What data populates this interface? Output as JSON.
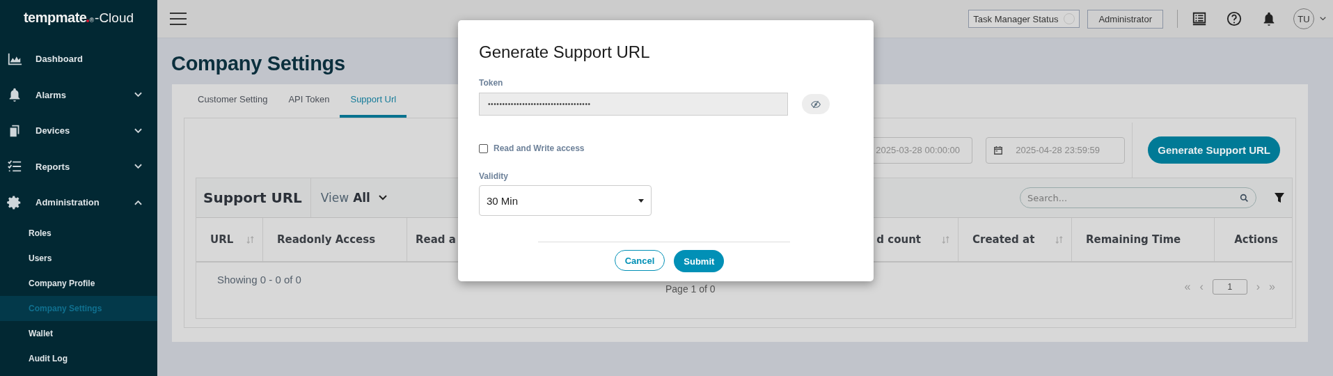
{
  "sidebar": {
    "logo": {
      "name": "tempmate",
      "mark": "®",
      "suffix": "-Cloud"
    },
    "items": [
      {
        "label": "Dashboard",
        "kind": "link"
      },
      {
        "label": "Alarms",
        "kind": "group",
        "expanded": false
      },
      {
        "label": "Devices",
        "kind": "group",
        "expanded": false
      },
      {
        "label": "Reports",
        "kind": "group",
        "expanded": false
      },
      {
        "label": "Administration",
        "kind": "group",
        "expanded": true,
        "children": [
          {
            "label": "Roles",
            "selected": false
          },
          {
            "label": "Users",
            "selected": false
          },
          {
            "label": "Company Profile",
            "selected": false
          },
          {
            "label": "Company Settings",
            "selected": true
          },
          {
            "label": "Wallet",
            "selected": false
          },
          {
            "label": "Audit Log",
            "selected": false
          }
        ]
      }
    ]
  },
  "topbar": {
    "task_status": "Task Manager Status",
    "role": "Administrator",
    "avatar": "TU"
  },
  "page": {
    "title": "Company Settings"
  },
  "tabs": [
    {
      "label": "Customer Setting",
      "selected": false
    },
    {
      "label": "API Token",
      "selected": false
    },
    {
      "label": "Support Url",
      "selected": true
    }
  ],
  "date_range": [
    "2025-03-28 00:00:00",
    "2025-04-28 23:59:59"
  ],
  "generate_button": "Generate Support URL",
  "table": {
    "title": "Support URL",
    "view_label": "View",
    "view_value": "All",
    "search_placeholder": "Search...",
    "columns": [
      {
        "label": "URL",
        "sortable": true
      },
      {
        "label": "Readonly Access",
        "sortable": false
      },
      {
        "label": "Read a"
      },
      {
        "label": "d count",
        "sortable": true
      },
      {
        "label": "Created at",
        "sortable": true
      },
      {
        "label": "Remaining Time",
        "sortable": false
      },
      {
        "label": "Actions",
        "sortable": false
      }
    ],
    "showing": "Showing 0 - 0 of 0",
    "page_info": "Page 1 of 0",
    "pager_first": "«",
    "pager_prev": "‹",
    "page_number": "1",
    "pager_next": "›",
    "pager_last": "»"
  },
  "modal": {
    "title": "Generate Support URL",
    "token_label": "Token",
    "token_value": "••••••••••••••••••••••••••••••••••••",
    "token_masked": true,
    "checkbox": {
      "label": "Read and Write access",
      "checked": false
    },
    "validity_label": "Validity",
    "validity_value": "30 Min",
    "cancel": "Cancel",
    "submit": "Submit"
  }
}
